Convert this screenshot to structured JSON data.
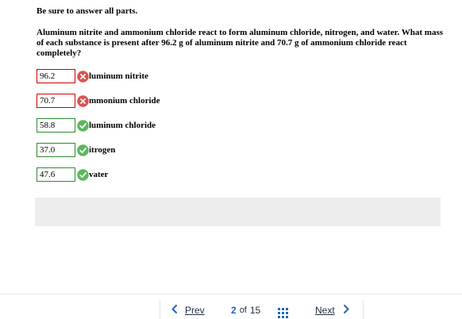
{
  "instructions": "Be sure to answer all parts.",
  "question": "Aluminum nitrite and ammonium chloride react to form aluminum chloride, nitrogen, and water. What mass of each substance is present after 96.2 g of aluminum nitrite and 70.7 g of ammonium chloride react completely?",
  "answers": [
    {
      "value": "96.2",
      "label": "luminum nitrite",
      "status": "incorrect"
    },
    {
      "value": "70.7",
      "label": "mmonium chloride",
      "status": "incorrect"
    },
    {
      "value": "58.8",
      "label": "luminum chloride",
      "status": "correct"
    },
    {
      "value": "37.0",
      "label": "itrogen",
      "status": "correct"
    },
    {
      "value": "47.6",
      "label": "vater",
      "status": "correct"
    }
  ],
  "navigation": {
    "prev_label": "Prev",
    "next_label": "Next",
    "current_page": "2",
    "of_text": "of",
    "total_pages": "15"
  },
  "colors": {
    "incorrect": "#d9534f",
    "correct": "#5cb85c",
    "accent": "#2466b8"
  },
  "icons": {
    "incorrect": "x-circle-icon",
    "correct": "check-circle-icon",
    "prev": "chevron-left-icon",
    "next": "chevron-right-icon",
    "grid": "grid-icon"
  }
}
